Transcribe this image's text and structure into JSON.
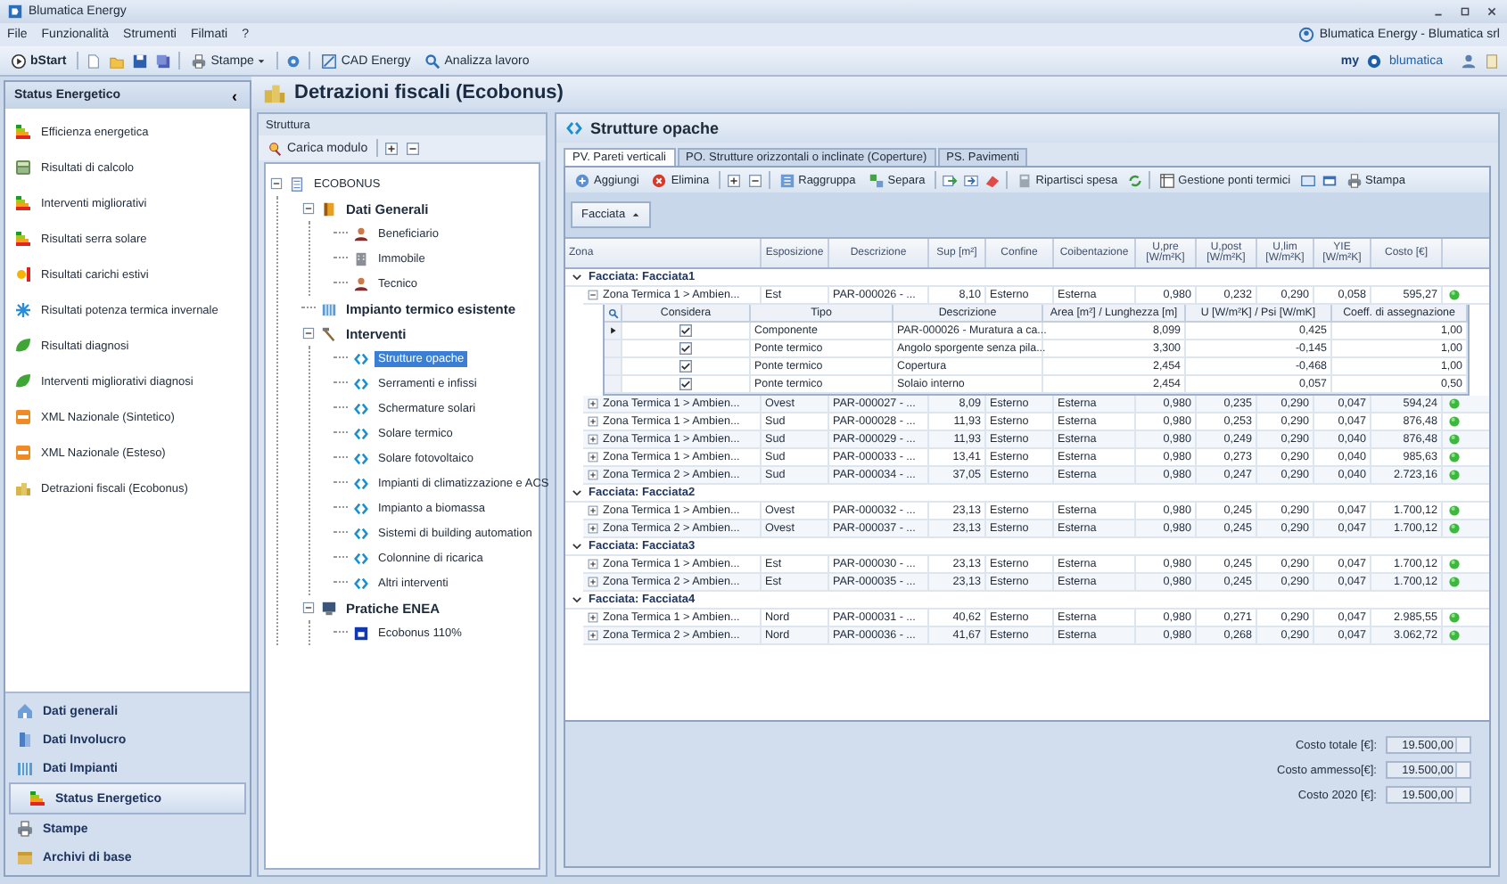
{
  "window": {
    "title": "Blumatica Energy"
  },
  "menu": [
    "File",
    "Funzionalità",
    "Strumenti",
    "Filmati",
    "?"
  ],
  "account": "Blumatica Energy - Blumatica srl",
  "toolbar": {
    "start": "bStart",
    "print": "Stampe",
    "cad": "CAD Energy",
    "analyze": "Analizza lavoro"
  },
  "brand": {
    "prefix": "my",
    "name": "blumatica"
  },
  "sidebar": {
    "title": "Status Energetico",
    "collapse": "‹",
    "items": [
      {
        "label": "Efficienza energetica",
        "selected": false
      },
      {
        "label": "Risultati di calcolo",
        "selected": false
      },
      {
        "label": "Interventi migliorativi",
        "selected": false
      },
      {
        "label": "Risultati serra solare",
        "selected": false
      },
      {
        "label": "Risultati carichi estivi",
        "selected": false
      },
      {
        "label": "Risultati potenza termica invernale",
        "selected": false
      },
      {
        "label": "Risultati diagnosi",
        "selected": false
      },
      {
        "label": "Interventi migliorativi diagnosi",
        "selected": false
      },
      {
        "label": "XML Nazionale (Sintetico)",
        "selected": false
      },
      {
        "label": "XML Nazionale (Esteso)",
        "selected": false
      },
      {
        "label": "Detrazioni fiscali (Ecobonus)",
        "selected": false
      }
    ]
  },
  "nav": [
    {
      "label": "Dati generali",
      "selected": false
    },
    {
      "label": "Dati Involucro",
      "selected": false
    },
    {
      "label": "Dati Impianti",
      "selected": false
    },
    {
      "label": "Status Energetico",
      "selected": true
    },
    {
      "label": "Stampe",
      "selected": false
    },
    {
      "label": "Archivi di base",
      "selected": false
    }
  ],
  "page_title": "Detrazioni fiscali (Ecobonus)",
  "structure": {
    "title": "Struttura",
    "load_button": "Carica modulo",
    "tree": [
      {
        "label": "ECOBONUS",
        "kind": "root",
        "selected": false,
        "expanded": true,
        "children": [
          {
            "label": "Dati Generali",
            "kind": "book",
            "selected": false,
            "expanded": true,
            "children": [
              {
                "label": "Beneficiario",
                "kind": "person",
                "selected": false
              },
              {
                "label": "Immobile",
                "kind": "building",
                "selected": false
              },
              {
                "label": "Tecnico",
                "kind": "person",
                "selected": false
              }
            ]
          },
          {
            "label": "Impianto termico esistente",
            "kind": "plant",
            "selected": false
          },
          {
            "label": "Interventi",
            "kind": "tools",
            "selected": false,
            "expanded": true,
            "children": [
              {
                "label": "Strutture opache",
                "kind": "chevron",
                "selected": true
              },
              {
                "label": "Serramenti e infissi",
                "kind": "chevron",
                "selected": false
              },
              {
                "label": "Schermature solari",
                "kind": "chevron",
                "selected": false
              },
              {
                "label": "Solare termico",
                "kind": "chevron",
                "selected": false
              },
              {
                "label": "Solare fotovoltaico",
                "kind": "chevron",
                "selected": false
              },
              {
                "label": "Impianti di climatizzazione e ACS",
                "kind": "chevron",
                "selected": false
              },
              {
                "label": "Impianto a biomassa",
                "kind": "chevron",
                "selected": false
              },
              {
                "label": "Sistemi di building automation",
                "kind": "chevron",
                "selected": false
              },
              {
                "label": "Colonnine di ricarica",
                "kind": "chevron",
                "selected": false
              },
              {
                "label": "Altri interventi",
                "kind": "chevron",
                "selected": false
              }
            ]
          },
          {
            "label": "Pratiche ENEA",
            "kind": "monitor",
            "selected": false,
            "expanded": true,
            "children": [
              {
                "label": "Ecobonus 110%",
                "kind": "form",
                "selected": false
              }
            ]
          }
        ]
      }
    ]
  },
  "panel": {
    "title": "Strutture opache",
    "tabs": [
      {
        "label": "PV. Pareti verticali",
        "selected": true
      },
      {
        "label": "PO. Strutture orizzontali o inclinate (Coperture)",
        "selected": false
      },
      {
        "label": "PS. Pavimenti",
        "selected": false
      }
    ],
    "actions": {
      "add": "Aggiungi",
      "delete": "Elimina",
      "group": "Raggruppa",
      "split": "Separa",
      "distribute": "Ripartisci spesa",
      "bridges": "Gestione ponti termici",
      "print": "Stampa"
    },
    "group_by": "Facciata",
    "columns": [
      {
        "label": "Zona"
      },
      {
        "label": "Esposizione"
      },
      {
        "label": "Descrizione"
      },
      {
        "label": "Sup [m²]"
      },
      {
        "label": "Confine"
      },
      {
        "label": "Coibentazione"
      },
      {
        "label": "U,pre",
        "unit": "[W/m²K]"
      },
      {
        "label": "U,post",
        "unit": "[W/m²K]"
      },
      {
        "label": "U,lim",
        "unit": "[W/m²K]"
      },
      {
        "label": "YIE",
        "unit": "[W/m²K]"
      },
      {
        "label": "Costo [€]"
      }
    ],
    "groups": [
      {
        "label": "Facciata: Facciata1",
        "expanded": true,
        "rows": [
          {
            "expanded": true,
            "cells": [
              "Zona Termica 1 > Ambien...",
              "Est",
              "PAR-000026 - ...",
              "8,10",
              "Esterno",
              "Esterna",
              "0,980",
              "0,232",
              "0,290",
              "0,058",
              "595,27"
            ],
            "details": {
              "columns": [
                "Considera",
                "Tipo",
                "Descrizione",
                "Area [m²] / Lunghezza [m]",
                "U [W/m²K] / Psi [W/mK]",
                "Coeff. di assegnazione"
              ],
              "rows": [
                {
                  "current": true,
                  "checked": true,
                  "cells": [
                    "",
                    "Componente",
                    "PAR-000026 - Muratura a ca...",
                    "8,099",
                    "0,425",
                    "1,00"
                  ]
                },
                {
                  "current": false,
                  "checked": true,
                  "cells": [
                    "",
                    "Ponte termico",
                    "Angolo sporgente senza pila...",
                    "3,300",
                    "-0,145",
                    "1,00"
                  ]
                },
                {
                  "current": false,
                  "checked": true,
                  "cells": [
                    "",
                    "Ponte termico",
                    "Copertura",
                    "2,454",
                    "-0,468",
                    "1,00"
                  ]
                },
                {
                  "current": false,
                  "checked": true,
                  "cells": [
                    "",
                    "Ponte termico",
                    "Solaio interno",
                    "2,454",
                    "0,057",
                    "0,50"
                  ]
                }
              ]
            }
          },
          {
            "expanded": false,
            "cells": [
              "Zona Termica 1 > Ambien...",
              "Ovest",
              "PAR-000027 - ...",
              "8,09",
              "Esterno",
              "Esterna",
              "0,980",
              "0,235",
              "0,290",
              "0,047",
              "594,24"
            ]
          },
          {
            "expanded": false,
            "cells": [
              "Zona Termica 1 > Ambien...",
              "Sud",
              "PAR-000028 - ...",
              "11,93",
              "Esterno",
              "Esterna",
              "0,980",
              "0,253",
              "0,290",
              "0,047",
              "876,48"
            ]
          },
          {
            "expanded": false,
            "cells": [
              "Zona Termica 1 > Ambien...",
              "Sud",
              "PAR-000029 - ...",
              "11,93",
              "Esterno",
              "Esterna",
              "0,980",
              "0,249",
              "0,290",
              "0,040",
              "876,48"
            ]
          },
          {
            "expanded": false,
            "cells": [
              "Zona Termica 1 > Ambien...",
              "Sud",
              "PAR-000033 - ...",
              "13,41",
              "Esterno",
              "Esterna",
              "0,980",
              "0,273",
              "0,290",
              "0,040",
              "985,63"
            ]
          },
          {
            "expanded": false,
            "cells": [
              "Zona Termica 2 > Ambien...",
              "Sud",
              "PAR-000034 - ...",
              "37,05",
              "Esterno",
              "Esterna",
              "0,980",
              "0,247",
              "0,290",
              "0,040",
              "2.723,16"
            ]
          }
        ]
      },
      {
        "label": "Facciata: Facciata2",
        "expanded": true,
        "rows": [
          {
            "expanded": false,
            "cells": [
              "Zona Termica 1 > Ambien...",
              "Ovest",
              "PAR-000032 - ...",
              "23,13",
              "Esterno",
              "Esterna",
              "0,980",
              "0,245",
              "0,290",
              "0,047",
              "1.700,12"
            ]
          },
          {
            "expanded": false,
            "cells": [
              "Zona Termica 2 > Ambien...",
              "Ovest",
              "PAR-000037 - ...",
              "23,13",
              "Esterno",
              "Esterna",
              "0,980",
              "0,245",
              "0,290",
              "0,047",
              "1.700,12"
            ]
          }
        ]
      },
      {
        "label": "Facciata: Facciata3",
        "expanded": true,
        "rows": [
          {
            "expanded": false,
            "cells": [
              "Zona Termica 1 > Ambien...",
              "Est",
              "PAR-000030 - ...",
              "23,13",
              "Esterno",
              "Esterna",
              "0,980",
              "0,245",
              "0,290",
              "0,047",
              "1.700,12"
            ]
          },
          {
            "expanded": false,
            "cells": [
              "Zona Termica 2 > Ambien...",
              "Est",
              "PAR-000035 - ...",
              "23,13",
              "Esterno",
              "Esterna",
              "0,980",
              "0,245",
              "0,290",
              "0,047",
              "1.700,12"
            ]
          }
        ]
      },
      {
        "label": "Facciata: Facciata4",
        "expanded": true,
        "rows": [
          {
            "expanded": false,
            "cells": [
              "Zona Termica 1 > Ambien...",
              "Nord",
              "PAR-000031 - ...",
              "40,62",
              "Esterno",
              "Esterna",
              "0,980",
              "0,271",
              "0,290",
              "0,047",
              "2.985,55"
            ]
          },
          {
            "expanded": false,
            "cells": [
              "Zona Termica 2 > Ambien...",
              "Nord",
              "PAR-000036 - ...",
              "41,67",
              "Esterno",
              "Esterna",
              "0,980",
              "0,268",
              "0,290",
              "0,047",
              "3.062,72"
            ]
          }
        ]
      }
    ],
    "totals": [
      {
        "label": "Costo totale [€]:",
        "value": "19.500,00"
      },
      {
        "label": "Costo ammesso[€]:",
        "value": "19.500,00"
      },
      {
        "label": "Costo 2020 [€]:",
        "value": "19.500,00"
      }
    ]
  }
}
